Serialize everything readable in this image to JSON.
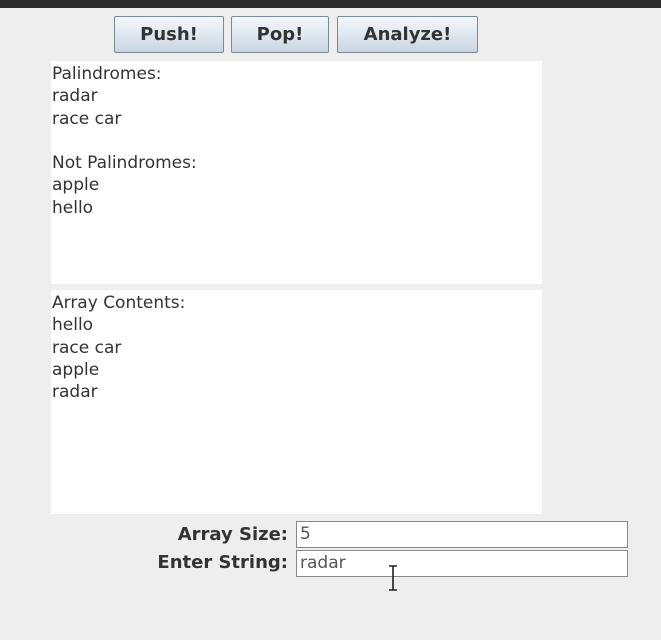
{
  "toolbar": {
    "push_label": "Push!",
    "pop_label": "Pop!",
    "analyze_label": "Analyze!"
  },
  "results_area": {
    "text": "Palindromes:\nradar\nrace car\n\nNot Palindromes:\napple\nhello"
  },
  "contents_area": {
    "text": "Array Contents:\nhello\nrace car\napple\nradar"
  },
  "form": {
    "array_size_label": "Array Size:",
    "array_size_value": "5",
    "enter_string_label": "Enter String:",
    "enter_string_value": "radar"
  },
  "cursor": {
    "icon": "text-cursor-icon"
  }
}
